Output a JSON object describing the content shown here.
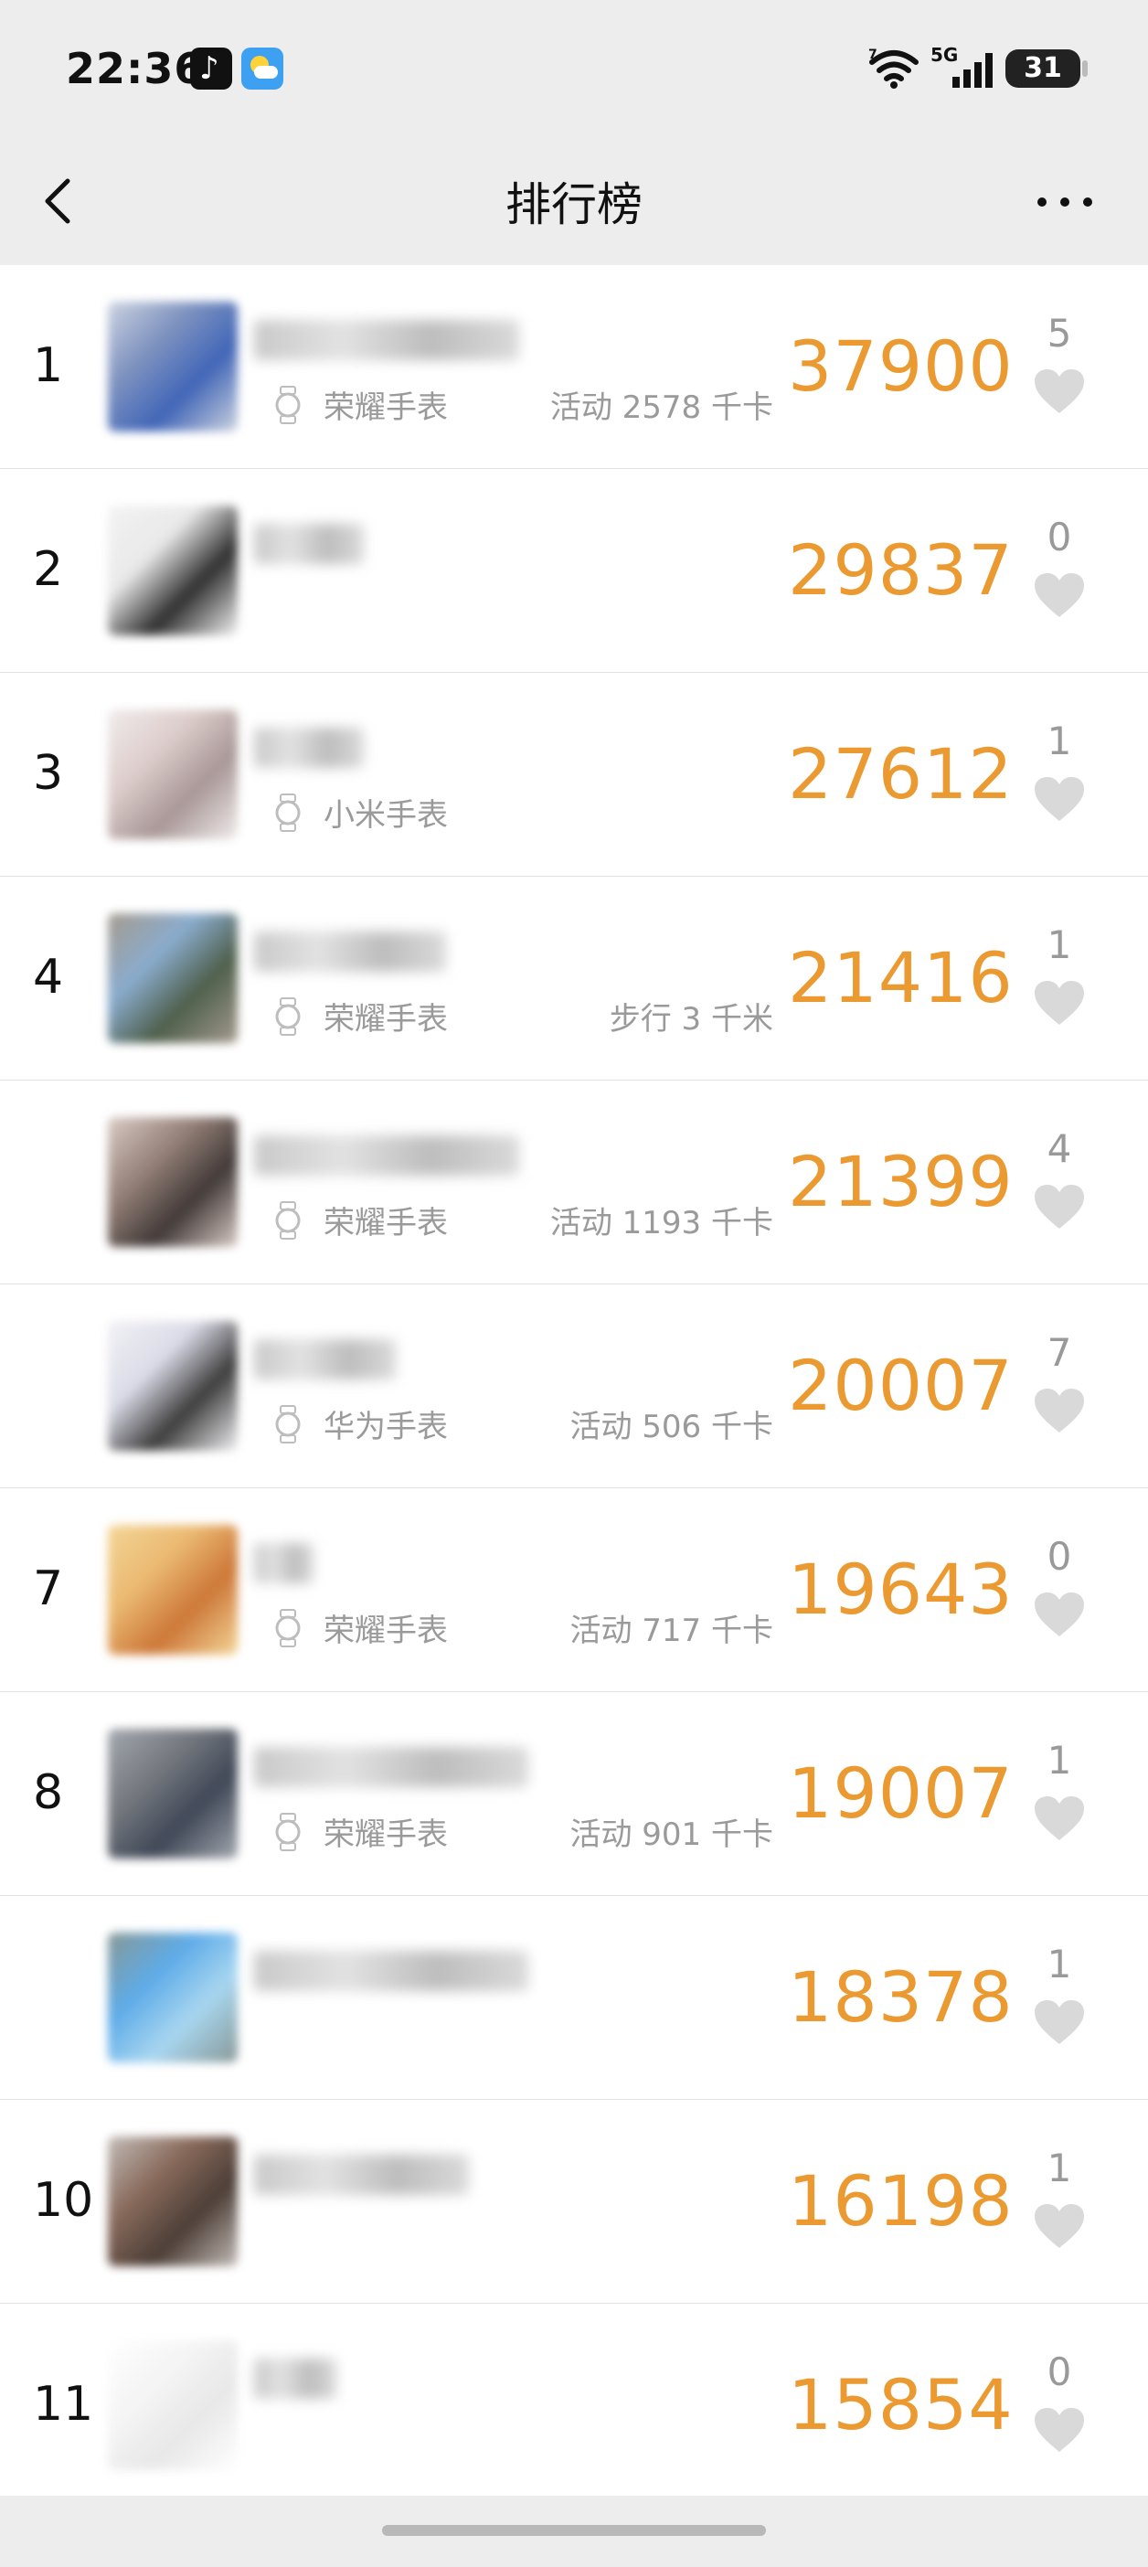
{
  "status_bar": {
    "time": "22:36",
    "signal_label": "5G",
    "wifi_label": "7",
    "battery": "31",
    "icons": [
      "tiktok-icon",
      "weather-icon",
      "wifi-icon",
      "signal-icon",
      "battery-icon"
    ]
  },
  "header": {
    "title": "排行榜",
    "back_icon": "chevron-left-icon",
    "more_icon": "more-dots-icon"
  },
  "colors": {
    "score": "#ea9a31",
    "muted": "#9a9a9a",
    "heart": "#d9d9d9"
  },
  "rows": [
    {
      "rank": "1",
      "device": "荣耀手表",
      "activity": "活动 2578 千卡",
      "score": "37900",
      "likes": "5"
    },
    {
      "rank": "2",
      "device": "",
      "activity": "",
      "score": "29837",
      "likes": "0"
    },
    {
      "rank": "3",
      "device": "小米手表",
      "activity": "",
      "score": "27612",
      "likes": "1"
    },
    {
      "rank": "4",
      "device": "荣耀手表",
      "activity": "步行 3 千米",
      "score": "21416",
      "likes": "1"
    },
    {
      "rank": "",
      "device": "荣耀手表",
      "activity": "活动 1193 千卡",
      "score": "21399",
      "likes": "4"
    },
    {
      "rank": "",
      "device": "华为手表",
      "activity": "活动 506 千卡",
      "score": "20007",
      "likes": "7"
    },
    {
      "rank": "7",
      "device": "荣耀手表",
      "activity": "活动 717 千卡",
      "score": "19643",
      "likes": "0"
    },
    {
      "rank": "8",
      "device": "荣耀手表",
      "activity": "活动 901 千卡",
      "score": "19007",
      "likes": "1"
    },
    {
      "rank": "",
      "device": "",
      "activity": "",
      "score": "18378",
      "likes": "1"
    },
    {
      "rank": "10",
      "device": "",
      "activity": "",
      "score": "16198",
      "likes": "1"
    },
    {
      "rank": "11",
      "device": "",
      "activity": "",
      "score": "15854",
      "likes": "0"
    }
  ]
}
